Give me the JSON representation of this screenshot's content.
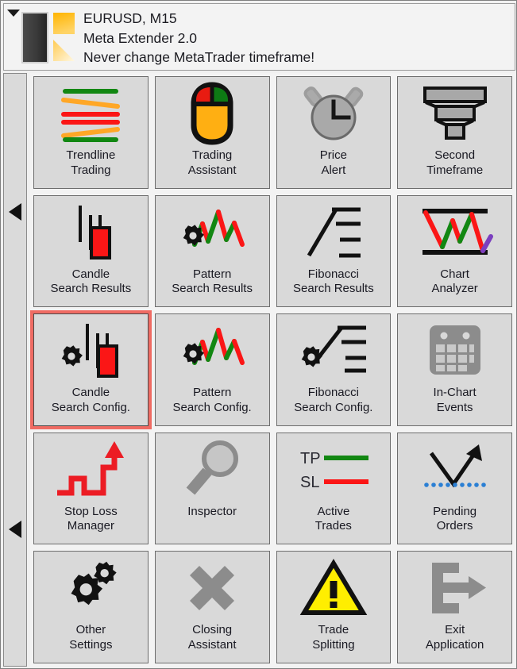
{
  "header": {
    "line1": "EURUSD, M15",
    "line2": "Meta Extender 2.0",
    "line3": "Never change MetaTrader timeframe!",
    "caret_icon": "chevron-down-icon",
    "logo_icon": "meta-extender-logo"
  },
  "sidebar": {
    "arrow_top_icon": "triangle-left-icon",
    "arrow_bottom_icon": "triangle-left-icon"
  },
  "colors": {
    "panel_bg": "#f3f3f3",
    "cell_bg": "#d9d9d9",
    "cell_border": "#6d6d6d",
    "sidebar_bg": "#dadada",
    "selection": "#ef6b63",
    "text": "#191922",
    "green": "#128712",
    "red": "#fb1616",
    "orange": "#ffa726",
    "amber": "#ffaf12",
    "yellow": "#ffee00",
    "gray_icon": "#8c8c8c",
    "gray_dark": "#a8a8a8",
    "blue_dots": "#2a7fd4",
    "purple": "#7b3fbf",
    "logo_dark": "#3a3a3a",
    "logo_yellow": "#ffb914"
  },
  "grid": {
    "columns": 4,
    "rows": 5,
    "selected_index": 8,
    "items": [
      {
        "index": 0,
        "label": "Trendline\nTrading",
        "icon": "trendline-lines-icon",
        "name": "tile-trendline-trading"
      },
      {
        "index": 1,
        "label": "Trading\nAssistant",
        "icon": "mouse-icon",
        "name": "tile-trading-assistant"
      },
      {
        "index": 2,
        "label": "Price\nAlert",
        "icon": "alarm-clock-icon",
        "name": "tile-price-alert"
      },
      {
        "index": 3,
        "label": "Second\nTimeframe",
        "icon": "funnel-stack-icon",
        "name": "tile-second-timeframe"
      },
      {
        "index": 4,
        "label": "Candle\nSearch Results",
        "icon": "candlestick-icon",
        "name": "tile-candle-search-results"
      },
      {
        "index": 5,
        "label": "Pattern\nSearch Results",
        "icon": "gear-zigzag-icon",
        "name": "tile-pattern-search-results"
      },
      {
        "index": 6,
        "label": "Fibonacci\nSearch Results",
        "icon": "fibonacci-lines-icon",
        "name": "tile-fibonacci-search-results"
      },
      {
        "index": 7,
        "label": "Chart\nAnalyzer",
        "icon": "chart-analyzer-icon",
        "name": "tile-chart-analyzer"
      },
      {
        "index": 8,
        "label": "Candle\nSearch Config.",
        "icon": "gear-candlestick-icon",
        "name": "tile-candle-search-config"
      },
      {
        "index": 9,
        "label": "Pattern\nSearch Config.",
        "icon": "gear-zigzag-icon",
        "name": "tile-pattern-search-config"
      },
      {
        "index": 10,
        "label": "Fibonacci\nSearch Config.",
        "icon": "gear-fibonacci-icon",
        "name": "tile-fibonacci-search-config"
      },
      {
        "index": 11,
        "label": "In-Chart\nEvents",
        "icon": "calendar-icon",
        "name": "tile-in-chart-events"
      },
      {
        "index": 12,
        "label": "Stop Loss\nManager",
        "icon": "staircase-arrow-icon",
        "name": "tile-stop-loss-manager"
      },
      {
        "index": 13,
        "label": "Inspector",
        "icon": "magnifier-icon",
        "name": "tile-inspector"
      },
      {
        "index": 14,
        "label": "Active\nTrades",
        "icon": "tp-sl-lines-icon",
        "name": "tile-active-trades"
      },
      {
        "index": 15,
        "label": "Pending\nOrders",
        "icon": "pending-arrow-icon",
        "name": "tile-pending-orders"
      },
      {
        "index": 16,
        "label": "Other\nSettings",
        "icon": "double-gear-icon",
        "name": "tile-other-settings"
      },
      {
        "index": 17,
        "label": "Closing\nAssistant",
        "icon": "cross-x-icon",
        "name": "tile-closing-assistant"
      },
      {
        "index": 18,
        "label": "Trade\nSplitting",
        "icon": "warning-triangle-icon",
        "name": "tile-trade-splitting"
      },
      {
        "index": 19,
        "label": "Exit\nApplication",
        "icon": "exit-arrow-icon",
        "name": "tile-exit-application"
      }
    ]
  },
  "icon_text": {
    "tp": "TP",
    "sl": "SL",
    "warning": "!"
  }
}
